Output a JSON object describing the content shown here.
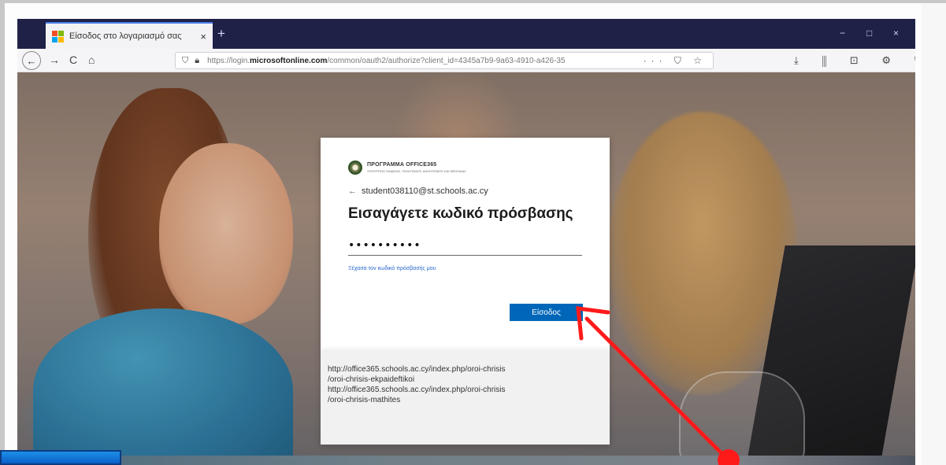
{
  "browser": {
    "tab_title": "Είσοδος στο λογαριασμό σας",
    "tab_close": "×",
    "new_tab": "+",
    "window_controls": {
      "minimize": "−",
      "maximize": "□",
      "close": "×"
    },
    "nav": {
      "back": "←",
      "forward": "→",
      "reload": "C",
      "home": "⌂"
    },
    "url_prefix": "https://login.",
    "url_domain": "microsoftonline.com",
    "url_rest": "/common/oauth2/authorize?client_id=4345a7b9-9a63-4910-a426-35",
    "url_actions": "··· ⛉ ☆",
    "toolbar_icons": "⤓ ⫼ ⊡ ⚙ ⛉ ≡"
  },
  "login": {
    "org_name": "ΠΡΟΓΡΑΜΜΑ OFFICE365",
    "org_subtitle": "ΥΠΟΥΡΓΕΙΟ ΠΑΙΔΕΙΑΣ, ΠΟΛΙΤΙΣΜΟΥ, ΑΘΛΗΤΙΣΜΟΥ ΚΑΙ ΝΕΟΛΑΙΑΣ",
    "identity_arrow": "←",
    "identity": "student038110@st.schools.ac.cy",
    "title": "Εισαγάγετε κωδικό πρόσβασης",
    "password_value": "••••••••••",
    "forgot_link": "Ξέχασα τον κωδικό πρόσβασής μου",
    "signin_label": "Είσοδος"
  },
  "footer": {
    "lines": [
      "http://office365.schools.ac.cy/index.php/oroi-chrisis",
      "/oroi-chrisis-ekpaideftikoi",
      "http://office365.schools.ac.cy/index.php/oroi-chrisis",
      "/oroi-chrisis-mathites"
    ]
  },
  "colors": {
    "accent": "#0067b8",
    "annotation_arrow": "#ff1a1a",
    "tabbar": "#1f2147"
  },
  "icons": {
    "back": "back-arrow-icon",
    "forward": "forward-arrow-icon",
    "reload": "reload-icon",
    "home": "home-icon",
    "shield": "shield-icon",
    "lock": "lock-icon"
  }
}
